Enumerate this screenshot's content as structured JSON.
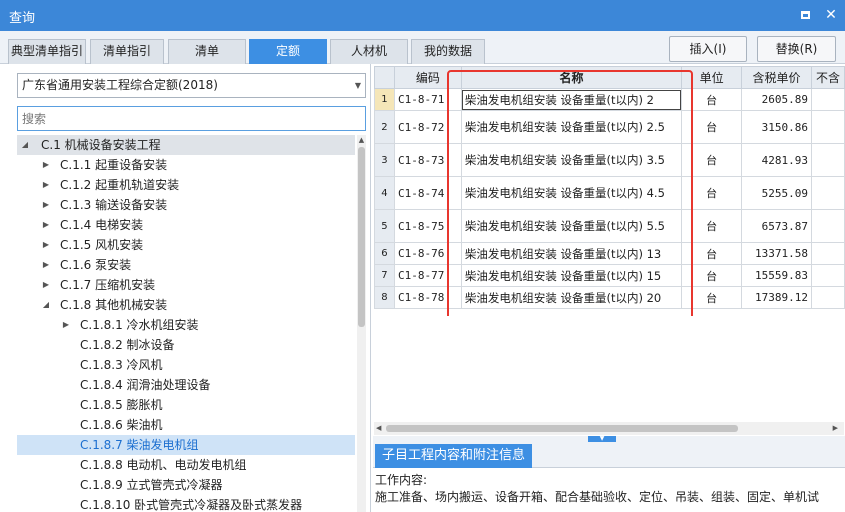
{
  "window": {
    "title": "查询"
  },
  "tabs": [
    {
      "label": "典型清单指引",
      "active": false
    },
    {
      "label": "清单指引",
      "active": false
    },
    {
      "label": "清单",
      "active": false
    },
    {
      "label": "定额",
      "active": true
    },
    {
      "label": "人材机",
      "active": false
    },
    {
      "label": "我的数据",
      "active": false
    }
  ],
  "toolbar": {
    "insert_label": "插入(I)",
    "replace_label": "替换(R)"
  },
  "sidebar": {
    "library": "广东省通用安装工程综合定额(2018)",
    "search_placeholder": "搜索",
    "tree": [
      {
        "label": "C.1 机械设备安装工程",
        "expanded": true
      },
      {
        "label": "C.1.1 起重设备安装",
        "expanded": false
      },
      {
        "label": "C.1.2 起重机轨道安装",
        "expanded": false
      },
      {
        "label": "C.1.3 输送设备安装",
        "expanded": false
      },
      {
        "label": "C.1.4 电梯安装",
        "expanded": false
      },
      {
        "label": "C.1.5 风机安装",
        "expanded": false
      },
      {
        "label": "C.1.6 泵安装",
        "expanded": false
      },
      {
        "label": "C.1.7 压缩机安装",
        "expanded": false
      },
      {
        "label": "C.1.8 其他机械安装",
        "expanded": true
      },
      {
        "label": "C.1.8.1 冷水机组安装",
        "expanded": false
      },
      {
        "label": "C.1.8.2 制冰设备"
      },
      {
        "label": "C.1.8.3 冷风机"
      },
      {
        "label": "C.1.8.4 润滑油处理设备"
      },
      {
        "label": "C.1.8.5 膨胀机"
      },
      {
        "label": "C.1.8.6 柴油机"
      },
      {
        "label": "C.1.8.7 柴油发电机组",
        "selected": true
      },
      {
        "label": "C.1.8.8 电动机、电动发电机组"
      },
      {
        "label": "C.1.8.9 立式管壳式冷凝器"
      },
      {
        "label": "C.1.8.10 卧式管壳式冷凝器及卧式蒸发器"
      }
    ]
  },
  "grid": {
    "columns": [
      "编码",
      "名称",
      "单位",
      "含税单价",
      "不含"
    ],
    "rows": [
      {
        "no": "1",
        "code": "C1-8-71",
        "name": "柴油发电机组安装 设备重量(t以内) 2",
        "unit": "台",
        "price": "2605.89"
      },
      {
        "no": "2",
        "code": "C1-8-72",
        "name": "柴油发电机组安装 设备重量(t以内) 2.5",
        "unit": "台",
        "price": "3150.86"
      },
      {
        "no": "3",
        "code": "C1-8-73",
        "name": "柴油发电机组安装 设备重量(t以内) 3.5",
        "unit": "台",
        "price": "4281.93"
      },
      {
        "no": "4",
        "code": "C1-8-74",
        "name": "柴油发电机组安装 设备重量(t以内) 4.5",
        "unit": "台",
        "price": "5255.09"
      },
      {
        "no": "5",
        "code": "C1-8-75",
        "name": "柴油发电机组安装 设备重量(t以内) 5.5",
        "unit": "台",
        "price": "6573.87"
      },
      {
        "no": "6",
        "code": "C1-8-76",
        "name": "柴油发电机组安装 设备重量(t以内) 13",
        "unit": "台",
        "price": "13371.58"
      },
      {
        "no": "7",
        "code": "C1-8-77",
        "name": "柴油发电机组安装 设备重量(t以内) 15",
        "unit": "台",
        "price": "15559.83"
      },
      {
        "no": "8",
        "code": "C1-8-78",
        "name": "柴油发电机组安装 设备重量(t以内) 20",
        "unit": "台",
        "price": "17389.12"
      }
    ]
  },
  "info": {
    "tab_label": "子目工程内容和附注信息",
    "work_label": "工作内容:",
    "work_text": "施工准备、场内搬运、设备开箱、配合基础验收、定位、吊装、组装、固定、单机试"
  },
  "colors": {
    "titlebar": "#3c87d8",
    "accent": "#3d8fe3",
    "highlight_box": "#e8362e"
  }
}
